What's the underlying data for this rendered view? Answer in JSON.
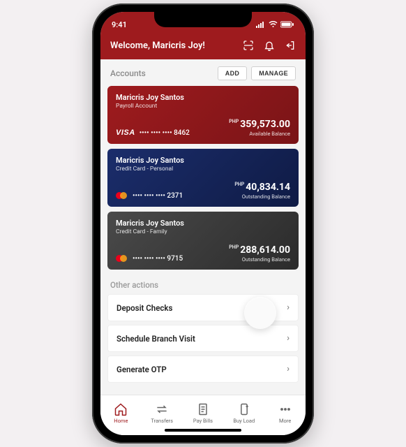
{
  "status": {
    "time": "9:41"
  },
  "header": {
    "welcome": "Welcome, Maricris Joy!"
  },
  "accounts": {
    "title": "Accounts",
    "add": "ADD",
    "manage": "MANAGE",
    "cards": [
      {
        "name": "Maricris Joy Santos",
        "type": "Payroll Account",
        "masked": "•••• •••• •••• 8462",
        "currency": "PHP",
        "amount": "359,573.00",
        "balance_label": "Available Balance",
        "brand": "visa"
      },
      {
        "name": "Maricris Joy Santos",
        "type": "Credit Card - Personal",
        "masked": "•••• •••• •••• 2371",
        "currency": "PHP",
        "amount": "40,834.14",
        "balance_label": "Outstanding Balance",
        "brand": "mastercard"
      },
      {
        "name": "Maricris Joy Santos",
        "type": "Credit Card - Family",
        "masked": "•••• •••• •••• 9715",
        "currency": "PHP",
        "amount": "288,614.00",
        "balance_label": "Outstanding Balance",
        "brand": "mastercard"
      }
    ]
  },
  "other": {
    "title": "Other actions",
    "items": [
      "Deposit Checks",
      "Schedule Branch Visit",
      "Generate OTP"
    ]
  },
  "tabs": [
    "Home",
    "Transfers",
    "Pay Bills",
    "Buy Load",
    "More"
  ]
}
